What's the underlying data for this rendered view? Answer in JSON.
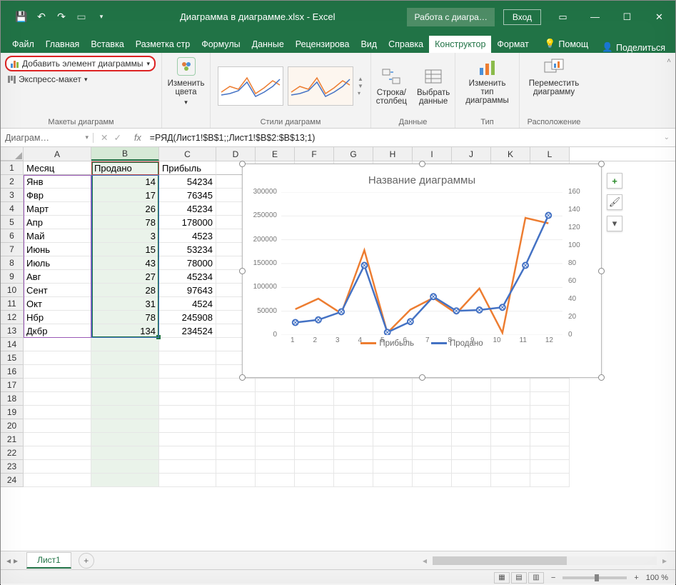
{
  "titlebar": {
    "filename": "Диаграмма в диаграмме.xlsx - Excel",
    "context": "Работа с диагра…",
    "login": "Вход"
  },
  "ribbon_tabs": {
    "file": "Файл",
    "home": "Главная",
    "insert": "Вставка",
    "layout": "Разметка стр",
    "formulas": "Формулы",
    "data": "Данные",
    "review": "Рецензирова",
    "view": "Вид",
    "help": "Справка",
    "design": "Конструктор",
    "format": "Формат",
    "help_q": "Помощ",
    "share": "Поделиться"
  },
  "ribbon": {
    "add_element": "Добавить элемент диаграммы",
    "quick_layout": "Экспресс-макет",
    "layouts_group": "Макеты диаграмм",
    "change_colors": "Изменить цвета",
    "styles_group": "Стили диаграмм",
    "switch_rowcol": "Строка/\nстолбец",
    "select_data": "Выбрать\nданные",
    "data_group": "Данные",
    "change_type": "Изменить тип\nдиаграммы",
    "type_group": "Тип",
    "move_chart": "Переместить\nдиаграмму",
    "location_group": "Расположение"
  },
  "formula": {
    "name_box": "Диаграм…",
    "text": "=РЯД(Лист1!$B$1;;Лист1!$B$2:$B$13;1)"
  },
  "columns": [
    "A",
    "B",
    "C",
    "D",
    "E",
    "F",
    "G",
    "H",
    "I",
    "J",
    "K",
    "L"
  ],
  "table": {
    "headers": {
      "A": "Месяц",
      "B": "Продано",
      "C": "Прибыль"
    },
    "rows": [
      {
        "month": "Янв",
        "sold": 14,
        "profit": 54234
      },
      {
        "month": "Фвр",
        "sold": 17,
        "profit": 76345
      },
      {
        "month": "Март",
        "sold": 26,
        "profit": 45234
      },
      {
        "month": "Апр",
        "sold": 78,
        "profit": 178000
      },
      {
        "month": "Май",
        "sold": 3,
        "profit": 4523
      },
      {
        "month": "Июнь",
        "sold": 15,
        "profit": 53234
      },
      {
        "month": "Июль",
        "sold": 43,
        "profit": 78000
      },
      {
        "month": "Авг",
        "sold": 27,
        "profit": 45234
      },
      {
        "month": "Сент",
        "sold": 28,
        "profit": 97643
      },
      {
        "month": "Окт",
        "sold": 31,
        "profit": 4524
      },
      {
        "month": "Нбр",
        "sold": 78,
        "profit": 245908
      },
      {
        "month": "Дкбр",
        "sold": 134,
        "profit": 234524
      }
    ]
  },
  "chart": {
    "title": "Название диаграммы",
    "legend_profit": "Прибыль",
    "legend_sold": "Продано"
  },
  "chart_data": {
    "type": "line",
    "title": "Название диаграммы",
    "x": [
      1,
      2,
      3,
      4,
      5,
      6,
      7,
      8,
      9,
      10,
      11,
      12
    ],
    "series": [
      {
        "name": "Прибыль",
        "axis": "left",
        "color": "#ed7d31",
        "values": [
          54234,
          76345,
          45234,
          178000,
          4523,
          53234,
          78000,
          45234,
          97643,
          4524,
          245908,
          234524
        ]
      },
      {
        "name": "Продано",
        "axis": "right",
        "color": "#4472c4",
        "values": [
          14,
          17,
          26,
          78,
          3,
          15,
          43,
          27,
          28,
          31,
          78,
          134
        ]
      }
    ],
    "y_left": {
      "min": 0,
      "max": 300000,
      "step": 50000
    },
    "y_right": {
      "min": 0,
      "max": 160,
      "step": 20
    },
    "xlabel": "",
    "ylabel": ""
  },
  "sheet": {
    "tab1": "Лист1"
  },
  "status": {
    "zoom": "100 %"
  }
}
